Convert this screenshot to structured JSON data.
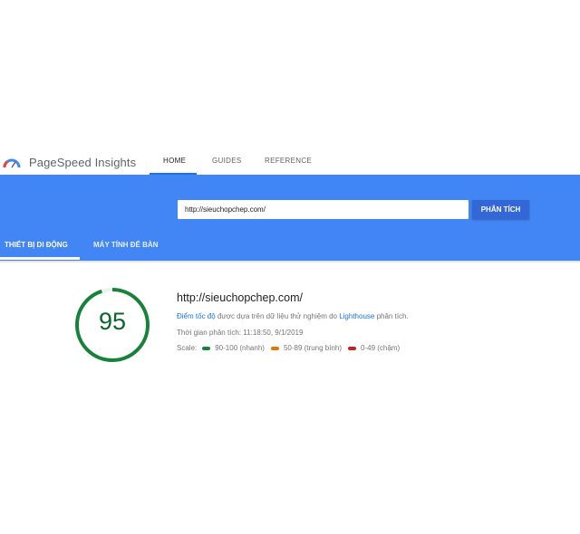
{
  "header": {
    "brand": "PageSpeed Insights",
    "nav": [
      {
        "label": "HOME",
        "active": true
      },
      {
        "label": "GUIDES",
        "active": false
      },
      {
        "label": "REFERENCE",
        "active": false
      }
    ],
    "logo_icon": "pagespeed-gauge-icon"
  },
  "search": {
    "url_value": "http://sieuchopchep.com/",
    "analyze_label": "PHÂN TÍCH"
  },
  "tabs": [
    {
      "label": "THIẾT BỊ DI ĐỘNG",
      "active": true
    },
    {
      "label": "MÁY TÍNH ĐỂ BÀN",
      "active": false
    }
  ],
  "result": {
    "score": "95",
    "score_value": 95,
    "url": "http://sieuchopchep.com/",
    "desc_link1": "Điểm tốc độ",
    "desc_mid": " được dựa trên dữ liệu thử nghiệm do ",
    "desc_link2": "Lighthouse",
    "desc_end": " phân tích.",
    "time": "Thời gian phân tích: 11:18:50, 9/1/2019",
    "scale_label": "Scale:",
    "scale": [
      {
        "label": "90-100 (nhanh)",
        "color": "#178239"
      },
      {
        "label": "50-89 (trung bình)",
        "color": "#e67700"
      },
      {
        "label": "0-49 (chậm)",
        "color": "#c7221f"
      }
    ]
  },
  "colors": {
    "accent": "#4285f4",
    "button": "#3367d6",
    "link": "#1a73e8",
    "score_good": "#178239"
  }
}
